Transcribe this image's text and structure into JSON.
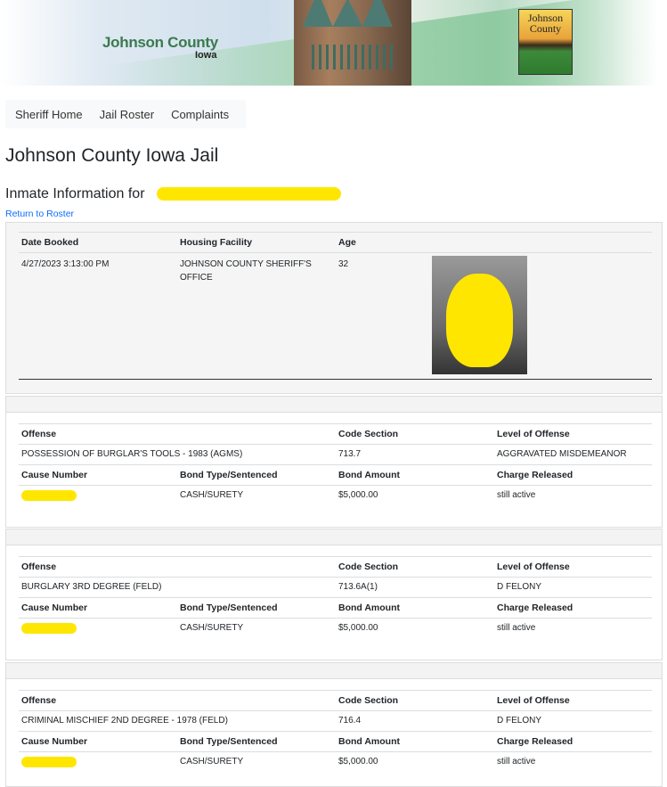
{
  "banner": {
    "title": "Johnson County",
    "subtitle": "Iowa",
    "logo_text": "Johnson County"
  },
  "nav": [
    {
      "label": "Sheriff Home"
    },
    {
      "label": "Jail Roster"
    },
    {
      "label": "Complaints"
    }
  ],
  "page_title": "Johnson County Iowa Jail",
  "inmate_heading": "Inmate Information for",
  "return_link": "Return to Roster",
  "booking": {
    "headers": [
      "Date Booked",
      "Housing Facility",
      "Age"
    ],
    "date_booked": "4/27/2023 3:13:00 PM",
    "housing_facility": "JOHNSON COUNTY SHERIFF'S OFFICE",
    "age": "32"
  },
  "charge_headers": {
    "offense": "Offense",
    "code": "Code Section",
    "level": "Level of Offense",
    "cause": "Cause Number",
    "bond_type": "Bond Type/Sentenced",
    "bond_amount": "Bond Amount",
    "released": "Charge Released"
  },
  "charges": [
    {
      "offense": "POSSESSION OF BURGLAR'S TOOLS - 1983 (AGMS)",
      "code": "713.7",
      "level": "AGGRAVATED MISDEMEANOR",
      "bond_type": "CASH/SURETY",
      "bond_amount": "$5,000.00",
      "released": "still active"
    },
    {
      "offense": "BURGLARY 3RD DEGREE (FELD)",
      "code": "713.6A(1)",
      "level": "D FELONY",
      "bond_type": "CASH/SURETY",
      "bond_amount": "$5,000.00",
      "released": "still active"
    },
    {
      "offense": "CRIMINAL MISCHIEF 2ND DEGREE - 1978 (FELD)",
      "code": "716.4",
      "level": "D FELONY",
      "bond_type": "CASH/SURETY",
      "bond_amount": "$5,000.00",
      "released": "still active"
    }
  ],
  "colors": {
    "link": "#0d6efd",
    "redaction": "#ffe600",
    "brand_green": "#3a7a4e"
  }
}
